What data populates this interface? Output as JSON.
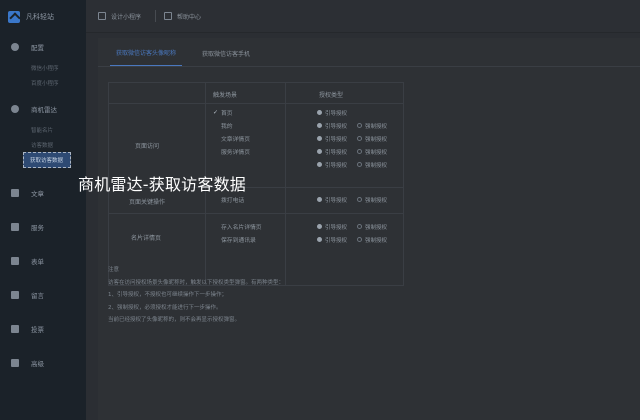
{
  "app": {
    "name": "凡科轻站"
  },
  "sidebar": {
    "items": [
      {
        "label": "配置",
        "icon": "gear-icon",
        "subs": [
          "微信小程序",
          "百度小程序"
        ]
      },
      {
        "label": "商机雷达",
        "icon": "radar-icon",
        "subs": [
          "智能名片",
          "访客数据",
          "获取访客数据"
        ]
      },
      {
        "label": "文章",
        "icon": "article-icon"
      },
      {
        "label": "服务",
        "icon": "service-icon"
      },
      {
        "label": "表单",
        "icon": "form-icon"
      },
      {
        "label": "留言",
        "icon": "message-icon"
      },
      {
        "label": "投票",
        "icon": "vote-icon"
      },
      {
        "label": "高级",
        "icon": "grid-icon"
      }
    ]
  },
  "topbar": {
    "design_label": "设计小程序",
    "help_label": "帮助中心"
  },
  "tabs": [
    "获取微信访客头像昵称",
    "获取微信访客手机"
  ],
  "table": {
    "col_trigger": "触发场景",
    "col_auth": "授权类型",
    "groups": [
      "页面访问",
      "页面关键操作",
      "名片详情页"
    ],
    "rows": [
      {
        "checked": true,
        "page": "首页",
        "opt1": "引导授权",
        "opt2": ""
      },
      {
        "checked": false,
        "page": "我的",
        "opt1": "引导授权",
        "opt2": "强制授权"
      },
      {
        "checked": false,
        "page": "文章详情页",
        "opt1": "引导授权",
        "opt2": "强制授权"
      },
      {
        "checked": false,
        "page": "服务详情页",
        "opt1": "引导授权",
        "opt2": "强制授权"
      },
      {
        "checked": false,
        "page": "",
        "opt1": "引导授权",
        "opt2": "强制授权"
      },
      {
        "checked": false,
        "page": "拨打电话",
        "opt1": "引导授权",
        "opt2": "强制授权"
      },
      {
        "checked": false,
        "page": "存入名片详情页",
        "opt1": "引导授权",
        "opt2": "强制授权"
      },
      {
        "checked": false,
        "page": "保存到通讯录",
        "opt1": "引导授权",
        "opt2": "强制授权"
      }
    ]
  },
  "notes": [
    "注意",
    "访客在访问授权场景头像昵称时，触发以下授权类型弹窗。有两种类型：",
    "1、引导授权，不授权也可继续操作下一步操作；",
    "2、强制授权，必须授权才能进行下一步操作。",
    "当前已经授权了头像昵称的，则不会再显示授权弹窗。"
  ],
  "tooltip": "商机雷达-获取访客数据"
}
